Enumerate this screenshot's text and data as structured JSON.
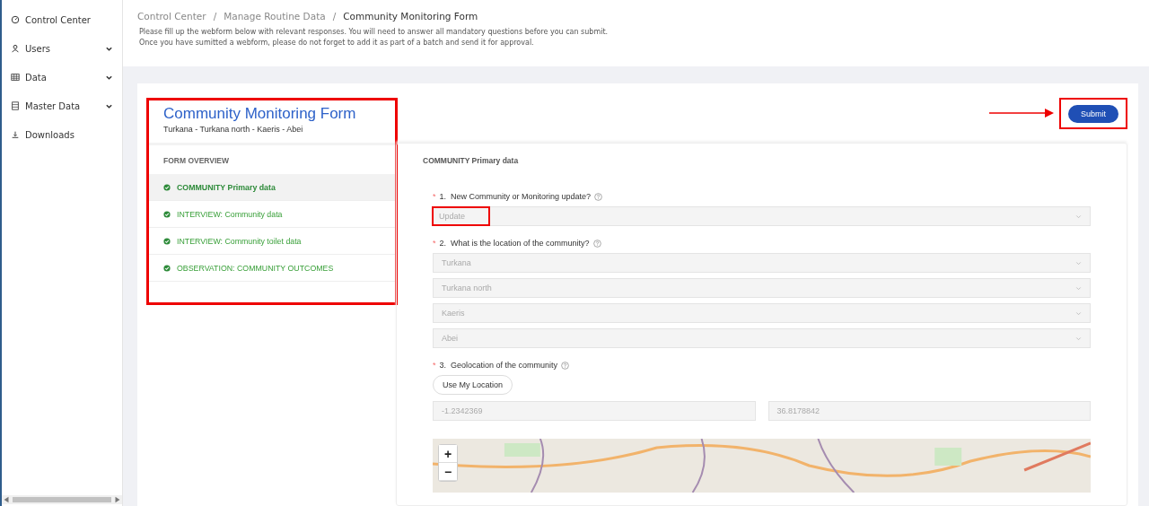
{
  "sidebar": {
    "items": [
      {
        "label": "Control Center",
        "expandable": false
      },
      {
        "label": "Users",
        "expandable": true
      },
      {
        "label": "Data",
        "expandable": true
      },
      {
        "label": "Master Data",
        "expandable": true
      },
      {
        "label": "Downloads",
        "expandable": false
      }
    ]
  },
  "breadcrumb": {
    "separator": "/",
    "items": [
      "Control Center",
      "Manage Routine Data",
      "Community Monitoring Form"
    ]
  },
  "instructions": [
    "Please fill up the webform below with relevant responses. You will need to answer all mandatory questions before you can submit.",
    "Once you have sumitted a webform, please do not forget to add it as part of a batch and send it for approval."
  ],
  "form": {
    "title": "Community Monitoring Form",
    "subtitle": "Turkana - Turkana north - Kaeris - Abei",
    "highlighted": true,
    "overview_heading": "FORM OVERVIEW",
    "sections": [
      {
        "label": "COMMUNITY Primary data",
        "selected": true,
        "completed": true
      },
      {
        "label": "INTERVIEW: Community data",
        "selected": false,
        "completed": true
      },
      {
        "label": "INTERVIEW: Community toilet data",
        "selected": false,
        "completed": true
      },
      {
        "label": "OBSERVATION: COMMUNITY OUTCOMES",
        "selected": false,
        "completed": true
      }
    ]
  },
  "submit": {
    "label": "Submit",
    "highlighted": true
  },
  "section_title": "COMMUNITY Primary data",
  "questions": [
    {
      "number": "1.",
      "label": "New Community or Monitoring update?",
      "required_mark": "*",
      "kind": "select",
      "fields": [
        {
          "value": "Update",
          "highlighted": true
        }
      ]
    },
    {
      "number": "2.",
      "label": "What is the location of the community?",
      "required_mark": "*",
      "kind": "select",
      "fields": [
        {
          "value": "Turkana",
          "highlighted": false
        },
        {
          "value": "Turkana north",
          "highlighted": false
        },
        {
          "value": "Kaeris",
          "highlighted": false
        },
        {
          "value": "Abei",
          "highlighted": false
        }
      ]
    },
    {
      "number": "3.",
      "label": "Geolocation of the community",
      "required_mark": "*",
      "kind": "geolocation",
      "button": "Use My Location",
      "fields": [
        {
          "value": "-1.2342369",
          "highlighted": false
        },
        {
          "value": "36.8178842",
          "highlighted": false
        }
      ]
    }
  ],
  "map": {
    "zoom_in": "+",
    "zoom_out": "−"
  }
}
